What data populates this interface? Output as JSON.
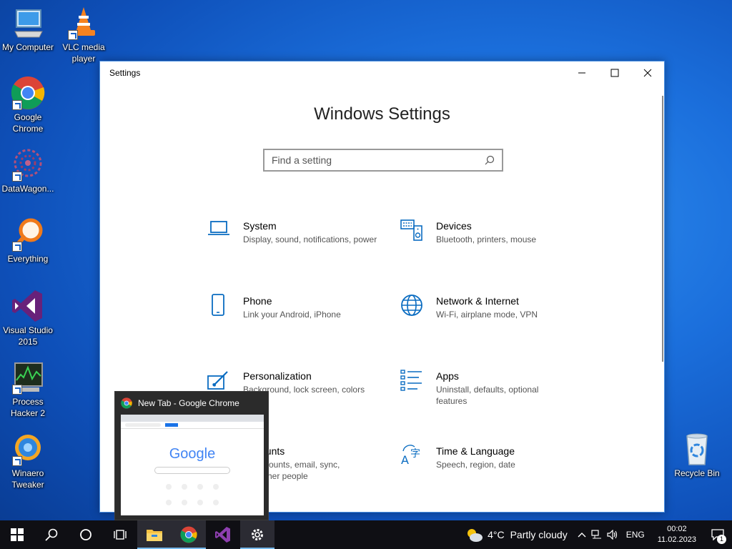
{
  "desktop": {
    "icons": [
      {
        "label": "My Computer"
      },
      {
        "label": "VLC media player"
      },
      {
        "label": "Google Chrome"
      },
      {
        "label": "DataWagon..."
      },
      {
        "label": "Everything"
      },
      {
        "label": "Visual Studio 2015"
      },
      {
        "label": "Process Hacker 2"
      },
      {
        "label": "Winaero Tweaker"
      },
      {
        "label": "Recycle Bin"
      }
    ]
  },
  "settings_window": {
    "title": "Settings",
    "heading": "Windows Settings",
    "search_placeholder": "Find a setting",
    "categories": [
      {
        "name": "System",
        "desc": "Display, sound, notifications, power",
        "icon": "laptop-icon"
      },
      {
        "name": "Devices",
        "desc": "Bluetooth, printers, mouse",
        "icon": "keyboard-speaker-icon"
      },
      {
        "name": "Phone",
        "desc": "Link your Android, iPhone",
        "icon": "phone-icon"
      },
      {
        "name": "Network & Internet",
        "desc": "Wi-Fi, airplane mode, VPN",
        "icon": "globe-icon"
      },
      {
        "name": "Personalization",
        "desc": "Background, lock screen, colors",
        "icon": "paint-icon"
      },
      {
        "name": "Apps",
        "desc": "Uninstall, defaults, optional features",
        "icon": "apps-list-icon"
      },
      {
        "name": "ounts",
        "desc": "ccounts, email, sync, other people",
        "icon": "accounts-icon"
      },
      {
        "name": "Time & Language",
        "desc": "Speech, region, date",
        "icon": "time-language-icon"
      }
    ]
  },
  "preview": {
    "title": "New Tab - Google Chrome",
    "google": "Google"
  },
  "taskbar": {
    "weather_temp": "4°C",
    "weather_text": "Partly cloudy",
    "lang": "ENG",
    "time": "00:02",
    "date": "11.02.2023",
    "notif_count": "1"
  },
  "colors": {
    "accent": "#0a6cc1",
    "taskbar": "#0f0f14"
  }
}
